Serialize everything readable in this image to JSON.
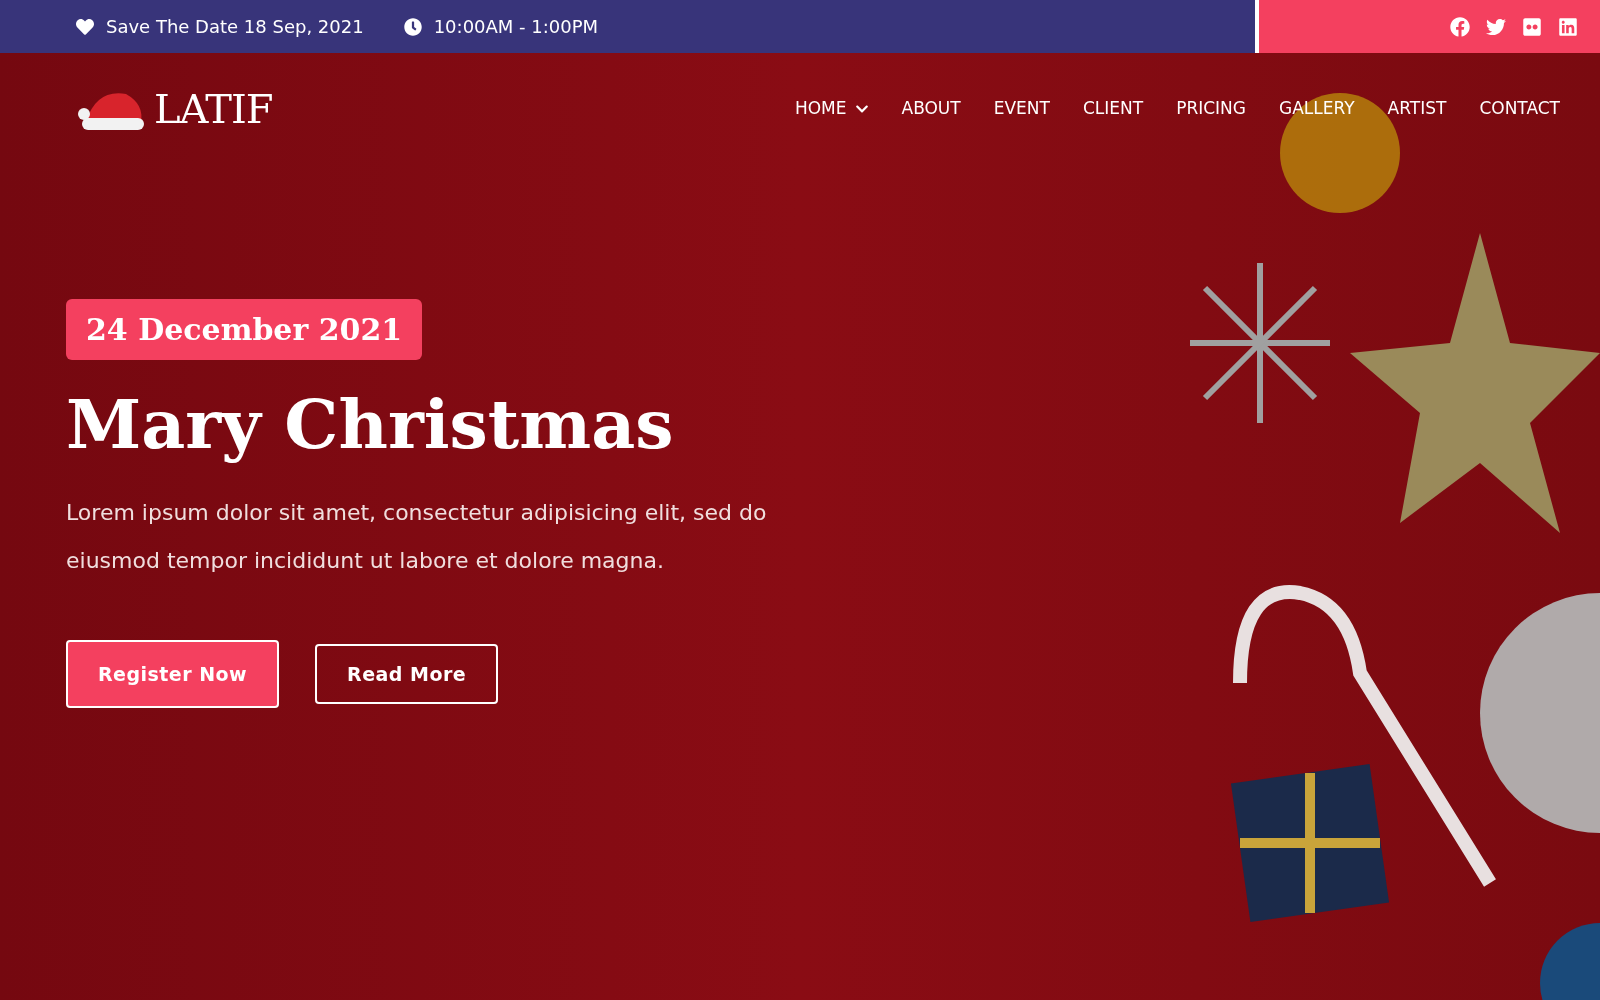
{
  "top_bar": {
    "date": "Save The Date 18 Sep, 2021",
    "time": "10:00AM - 1:00PM"
  },
  "logo": {
    "text": "LATIF"
  },
  "nav": [
    {
      "label": "HOME",
      "has_dropdown": true
    },
    {
      "label": "ABOUT",
      "has_dropdown": false
    },
    {
      "label": "EVENT",
      "has_dropdown": false
    },
    {
      "label": "CLIENT",
      "has_dropdown": false
    },
    {
      "label": "PRICING",
      "has_dropdown": false
    },
    {
      "label": "GALLERY",
      "has_dropdown": false
    },
    {
      "label": "ARTIST",
      "has_dropdown": false
    },
    {
      "label": "CONTACT",
      "has_dropdown": false
    }
  ],
  "hero": {
    "date_badge": "24 December 2021",
    "title": "Mary Christmas",
    "text": "Lorem ipsum dolor sit amet, consectetur adipisicing elit, sed do eiusmod tempor incididunt ut labore et dolore magna.",
    "buttons": [
      {
        "label": "Register Now",
        "kind": "primary"
      },
      {
        "label": "Read More",
        "kind": "outline"
      }
    ]
  }
}
